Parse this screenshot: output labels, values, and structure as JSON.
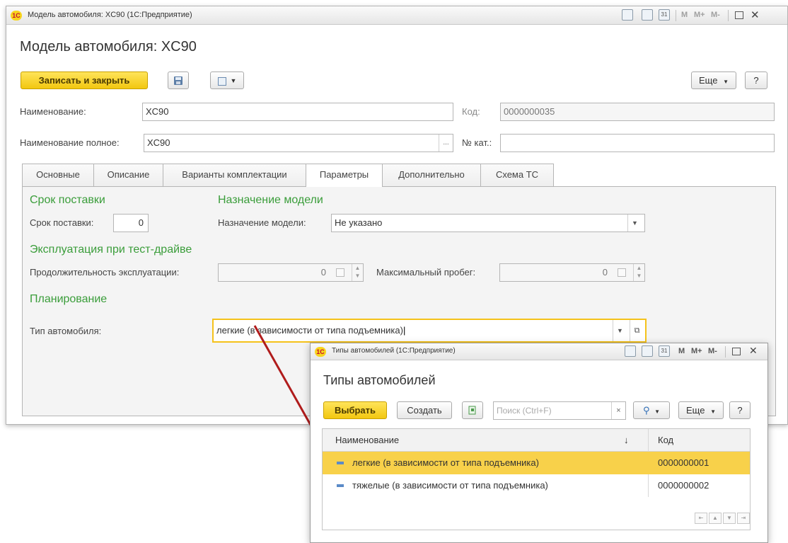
{
  "main_window": {
    "title": "Модель автомобиля: XC90  (1С:Предприятие)",
    "toolbar_right": [
      "M",
      "M+",
      "M-"
    ],
    "form_title": "Модель автомобиля: XC90",
    "buttons": {
      "save_close": "Записать и закрыть",
      "more": "Еще",
      "help": "?"
    },
    "fields": {
      "name_label": "Наименование:",
      "name_value": "XC90",
      "code_label": "Код:",
      "code_value": "0000000035",
      "full_name_label": "Наименование полное:",
      "full_name_value": "XC90",
      "full_name_btn": "...",
      "cat_label": "№ кат.:",
      "cat_value": ""
    },
    "tabs": [
      "Основные",
      "Описание",
      "Варианты комплектации",
      "Параметры",
      "Дополнительно",
      "Схема ТС"
    ],
    "active_tab": "Параметры",
    "params": {
      "delivery_group": "Срок поставки",
      "delivery_label": "Срок поставки:",
      "delivery_value": "0",
      "purpose_group": "Назначение модели",
      "purpose_label": "Назначение модели:",
      "purpose_value": "Не указано",
      "testdrive_group": "Эксплуатация при тест-драйве",
      "duration_label": "Продолжительность эксплуатации:",
      "duration_value": "0",
      "mileage_label": "Максимальный пробег:",
      "mileage_value": "0",
      "planning_group": "Планирование",
      "type_label": "Тип автомобиля:",
      "type_value": "легкие (в зависимости от типа подъемника)"
    }
  },
  "popup_window": {
    "title": "Типы автомобилей  (1С:Предприятие)",
    "toolbar_right": [
      "M",
      "M+",
      "M-"
    ],
    "form_title": "Типы автомобилей",
    "buttons": {
      "select": "Выбрать",
      "create": "Создать",
      "more": "Еще",
      "help": "?"
    },
    "search_placeholder": "Поиск (Ctrl+F)",
    "columns": {
      "name": "Наименование",
      "sort": "↓",
      "code": "Код"
    },
    "rows": [
      {
        "name": "легкие (в зависимости от типа подъемника)",
        "code": "0000000001",
        "selected": true
      },
      {
        "name": "тяжелые (в зависимости от типа подъемника)",
        "code": "0000000002",
        "selected": false
      }
    ]
  },
  "colors": {
    "accent_yellow": "#f5c21b",
    "group_green": "#3a9d3a",
    "arrow_red": "#b01c1c",
    "selection": "#f8d14a"
  }
}
